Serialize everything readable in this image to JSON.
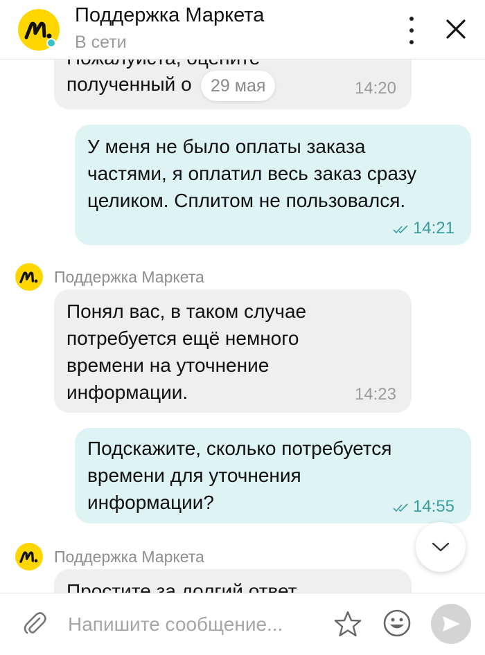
{
  "header": {
    "title": "Поддержка Маркета",
    "status": "В сети"
  },
  "chat": {
    "date_separator": "29 мая",
    "messages": [
      {
        "direction": "in",
        "text_line1": "Пожалуйста, оцените",
        "text_line2": "полученный о",
        "time": "14:20"
      },
      {
        "direction": "out",
        "lines": [
          "У меня не было оплаты заказа",
          "частями, я оплатил весь заказ сразу",
          "целиком. Сплитом не пользовался."
        ],
        "time": "14:21"
      },
      {
        "direction": "in",
        "sender": "Поддержка Маркета",
        "lines": [
          "Понял вас, в таком случае",
          "потребуется ещё немного",
          "времени на уточнение",
          "информации."
        ],
        "time": "14:23"
      },
      {
        "direction": "out",
        "lines": [
          "Подскажите, сколько потребуется",
          "времени для уточнения",
          "информации?"
        ],
        "time": "14:55"
      },
      {
        "direction": "in",
        "sender": "Поддержка Маркета",
        "lines": [
          "Простите за долгий ответ"
        ]
      }
    ]
  },
  "input": {
    "placeholder": "Напишите сообщение..."
  },
  "colors": {
    "brand_yellow": "#ffd600",
    "incoming_bubble": "#efefef",
    "outgoing_bubble": "#def3f3",
    "online_dot": "#3ac0c0",
    "read_check": "#3a9d9d"
  },
  "icons": {
    "header_avatar": "market-logo-icon",
    "menu": "kebab-menu-icon",
    "close": "close-icon",
    "scroll": "chevron-down-icon",
    "attach": "paperclip-icon",
    "favorite": "star-icon",
    "emoji": "smile-icon",
    "send": "send-icon"
  }
}
